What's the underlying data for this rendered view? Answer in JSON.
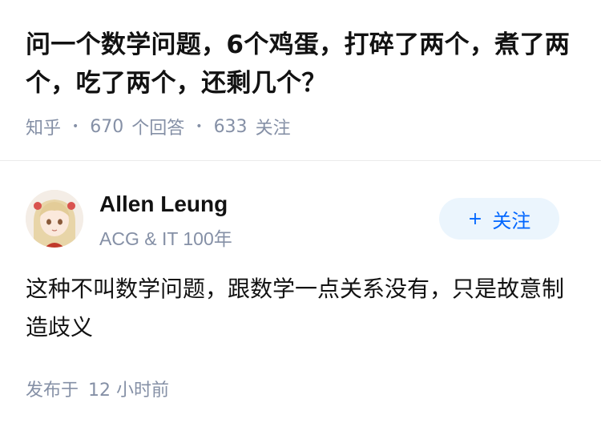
{
  "question": {
    "title": "问一个数学问题，6个鸡蛋，打碎了两个，煮了两个，吃了两个，还剩几个？",
    "source": "知乎",
    "answer_count": "670",
    "answer_label": "个回答",
    "follow_count": "633",
    "follow_label": "关注"
  },
  "answer": {
    "author_name": "Allen Leung",
    "author_desc": "ACG & IT 100年",
    "follow_button": "关注",
    "content": "这种不叫数学问题，跟数学一点关系没有，只是故意制造歧义",
    "time_prefix": "发布于",
    "time_value": "12 小时前"
  },
  "colors": {
    "accent": "#0066ff",
    "button_bg": "#ebf5fd",
    "meta_text": "#8590a6"
  }
}
